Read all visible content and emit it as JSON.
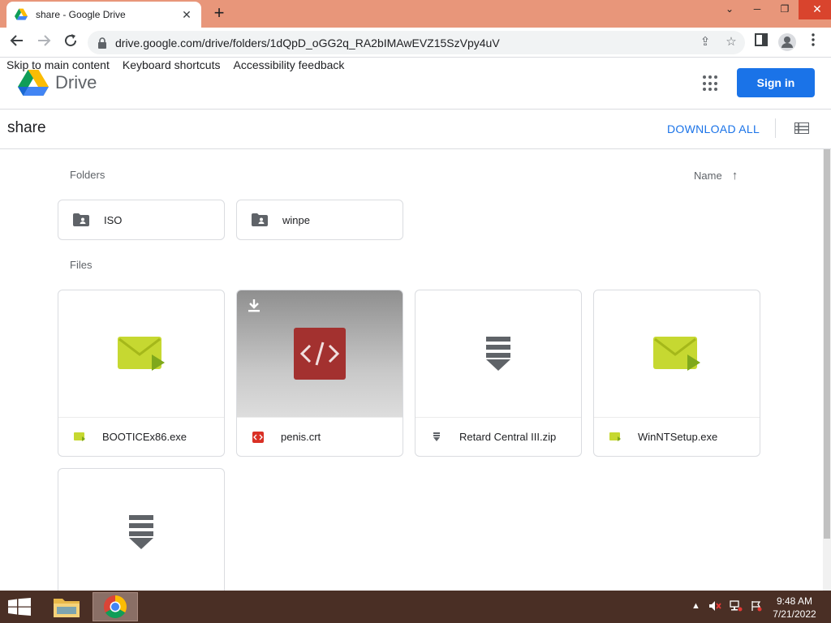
{
  "browser": {
    "tab_title": "share - Google Drive",
    "tab_close": "✕",
    "new_tab": "+",
    "url": "drive.google.com/drive/folders/1dQpD_oGG2q_RA2bIMAwEVZ15SzVpy4uV",
    "window_controls": {
      "minimize": "─",
      "restore": "❐",
      "close": "✕",
      "chevron": "⌄"
    }
  },
  "skip_links": [
    "Skip to main content",
    "Keyboard shortcuts",
    "Accessibility feedback"
  ],
  "drive_header": {
    "product_name": "Drive",
    "sign_in_label": "Sign in"
  },
  "folder_bar": {
    "title": "share",
    "download_all_label": "DOWNLOAD ALL"
  },
  "content": {
    "folders_label": "Folders",
    "files_label": "Files",
    "sort_label": "Name",
    "sort_arrow": "↑",
    "folders": [
      {
        "name": "ISO"
      },
      {
        "name": "winpe"
      }
    ],
    "files": [
      {
        "name": "BOOTICEx86.exe",
        "type": "exe"
      },
      {
        "name": "penis.crt",
        "type": "code"
      },
      {
        "name": "Retard Central III.zip",
        "type": "archive"
      },
      {
        "name": "WinNTSetup.exe",
        "type": "exe"
      },
      {
        "name": "",
        "type": "archive"
      }
    ]
  },
  "taskbar": {
    "time": "9:48 AM",
    "date": "7/21/2022",
    "tray_arrow": "▲"
  },
  "colors": {
    "tabstrip": "#e8967a",
    "accent_blue": "#1a73e8",
    "taskbar": "#4a2f25",
    "exe_green": "#c6d831",
    "code_red": "#a3312f"
  }
}
